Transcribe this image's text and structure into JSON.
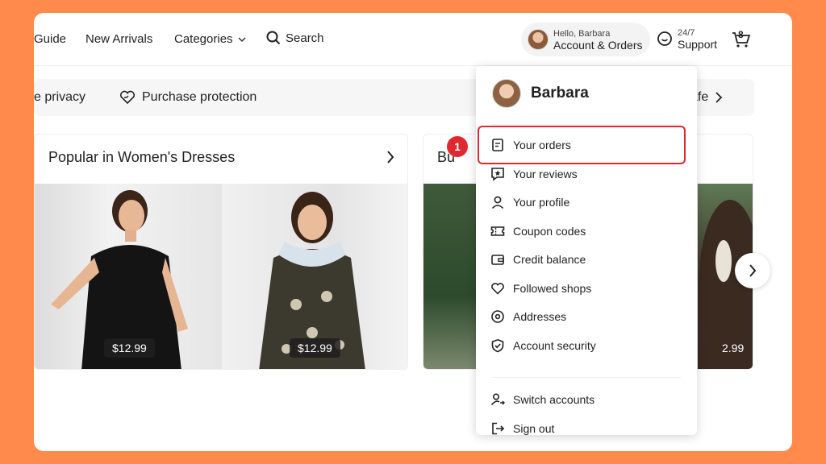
{
  "nav": {
    "guide": "Guide",
    "new_arrivals": "New Arrivals",
    "categories": "Categories",
    "search": "Search"
  },
  "account": {
    "greeting": "Hello, Barbara",
    "label": "Account & Orders"
  },
  "support": {
    "line1": "24/7",
    "line2": "Support"
  },
  "cart": {
    "count": "8"
  },
  "strip": {
    "privacy": "e privacy",
    "protection": "Purchase protection",
    "safe": "afe"
  },
  "cards": [
    {
      "title": "Popular in Women's Dresses",
      "prices": [
        "$12.99",
        "$12.99"
      ]
    },
    {
      "title": "Bu",
      "prices": [
        "2.99"
      ]
    }
  ],
  "dropdown": {
    "name": "Barbara",
    "items": [
      {
        "label": "Your orders",
        "icon": "orders-icon"
      },
      {
        "label": "Your reviews",
        "icon": "reviews-icon"
      },
      {
        "label": "Your profile",
        "icon": "profile-icon"
      },
      {
        "label": "Coupon codes",
        "icon": "coupon-icon"
      },
      {
        "label": "Credit balance",
        "icon": "wallet-icon"
      },
      {
        "label": "Followed shops",
        "icon": "heart-icon"
      },
      {
        "label": "Addresses",
        "icon": "location-icon"
      },
      {
        "label": "Account security",
        "icon": "shield-icon"
      },
      {
        "label": "Switch accounts",
        "icon": "switch-accounts-icon"
      },
      {
        "label": "Sign out",
        "icon": "sign-out-icon"
      }
    ]
  },
  "annotation": {
    "step": "1"
  },
  "colors": {
    "background": "#FF8A4C",
    "highlight": "#E0282E"
  }
}
